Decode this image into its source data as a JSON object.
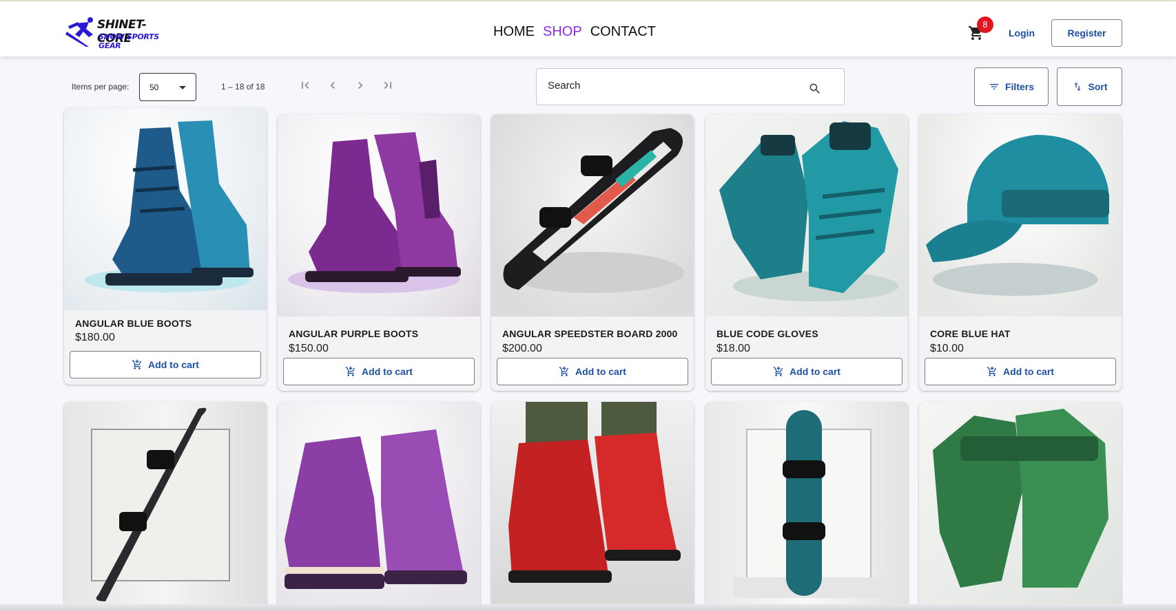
{
  "brand": {
    "line1": "SHINET-CORE",
    "line2": "SNOW SPORTS GEAR",
    "color": "#2a1ad8"
  },
  "nav": [
    {
      "label": "HOME"
    },
    {
      "label": "SHOP",
      "active": true
    },
    {
      "label": "CONTACT"
    }
  ],
  "header": {
    "cart_count": "8",
    "login_label": "Login",
    "register_label": "Register"
  },
  "toolbar": {
    "items_per_page_label": "Items per page:",
    "items_per_page_value": "50",
    "range_label": "1 – 18 of 18",
    "search_placeholder": "Search",
    "filters_label": "Filters",
    "sort_label": "Sort"
  },
  "products": [
    {
      "name": "ANGULAR BLUE BOOTS",
      "price": "$180.00",
      "cta": "Add to cart",
      "image": "blue-boots"
    },
    {
      "name": "ANGULAR PURPLE BOOTS",
      "price": "$150.00",
      "cta": "Add to cart",
      "image": "purple-boots"
    },
    {
      "name": "ANGULAR SPEEDSTER BOARD 2000",
      "price": "$200.00",
      "cta": "Add to cart",
      "image": "speedster-board"
    },
    {
      "name": "BLUE CODE GLOVES",
      "price": "$18.00",
      "cta": "Add to cart",
      "image": "blue-gloves"
    },
    {
      "name": "CORE BLUE HAT",
      "price": "$10.00",
      "cta": "Add to cart",
      "image": "blue-hat"
    },
    {
      "image": "dark-snowboard"
    },
    {
      "image": "purple-boots-2"
    },
    {
      "image": "red-boots"
    },
    {
      "image": "teal-snowboard"
    },
    {
      "image": "green-gloves"
    }
  ],
  "colors": {
    "accent": "#1c4fa0",
    "active_nav": "#8a2be2",
    "badge": "#e0151f"
  }
}
